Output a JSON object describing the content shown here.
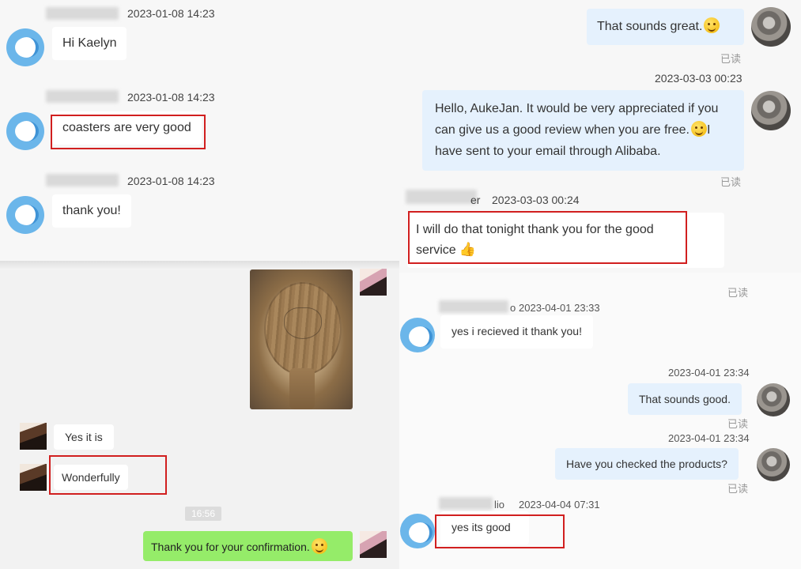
{
  "left_top": {
    "messages": [
      {
        "time": "2023-01-08 14:23",
        "text": "Hi Kaelyn"
      },
      {
        "time": "2023-01-08 14:23",
        "text": "coasters are very good"
      },
      {
        "time": "2023-01-08 14:23",
        "text": "thank you!"
      }
    ]
  },
  "right_top": {
    "msg1": {
      "text": "That sounds great.",
      "read": "已读"
    },
    "time2": "2023-03-03 00:23",
    "msg2": {
      "line1": "Hello, AukeJan. It would be very appreciated if you",
      "line2": "can give us a good review when you are free.",
      "line3": "have sent to your email through Alibaba.",
      "line2_tail": "I",
      "read": "已读"
    },
    "reply": {
      "sender_fragment": "er",
      "time": "2023-03-03 00:24",
      "line1": "I will do that tonight thank you for the good",
      "line2": "service"
    }
  },
  "left_bottom": {
    "msg_yes": "Yes it is",
    "msg_wonderfully": "Wonderfully",
    "time_chip": "16:56",
    "msg_thanks": "Thank you for your confirmation."
  },
  "right_bottom": {
    "read_top": "已读",
    "msg1": {
      "sender_fragment": "o",
      "time": "2023-04-01 23:33",
      "text": "yes i recieved it thank you!"
    },
    "msg2": {
      "time": "2023-04-01 23:34",
      "text": "That sounds good.",
      "read": "已读"
    },
    "msg3": {
      "time": "2023-04-01 23:34",
      "text": "Have you checked the products?",
      "read": "已读"
    },
    "msg4": {
      "sender_fragment": "lio",
      "time": "2023-04-04 07:31",
      "text": "yes its good"
    }
  },
  "colors": {
    "highlight": "#d11f1f",
    "own_bubble": "#e5f1fd",
    "wechat_green": "#95ec69"
  }
}
